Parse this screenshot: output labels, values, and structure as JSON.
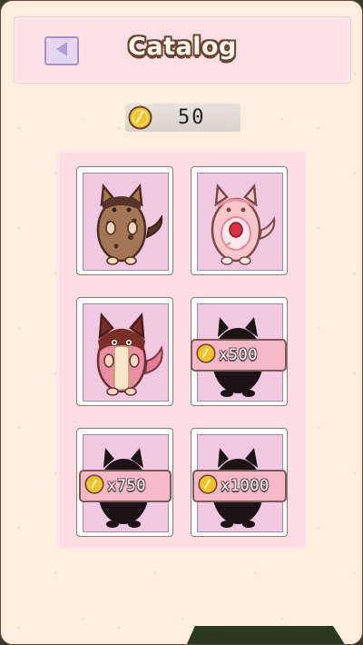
{
  "screen": {
    "title": "Catalog",
    "back_button_icon": "back-arrow-icon"
  },
  "wallet": {
    "coin_icon": "gold-coin-icon",
    "coins": "50"
  },
  "catalog": {
    "items": [
      {
        "id": "cookie-cat",
        "unlocked": true,
        "icon": "cookie-cat-icon",
        "price": ""
      },
      {
        "id": "donut-cat",
        "unlocked": true,
        "icon": "donut-cat-icon",
        "price": ""
      },
      {
        "id": "chocolate-cat",
        "unlocked": true,
        "icon": "chocolate-cat-icon",
        "price": ""
      },
      {
        "id": "locked-cat-1",
        "unlocked": false,
        "icon": "silhouette-cat-icon",
        "price": "x500"
      },
      {
        "id": "locked-cat-2",
        "unlocked": false,
        "icon": "silhouette-cat-icon",
        "price": "x750"
      },
      {
        "id": "locked-cat-3",
        "unlocked": false,
        "icon": "silhouette-cat-icon",
        "price": "x1000"
      }
    ]
  },
  "colors": {
    "background": "#fdeedd",
    "header_bg": "#fce0e4",
    "card_bg": "#f0c9e0",
    "price_tag": "#f7b8c6",
    "coin": "#f2c12e",
    "outline": "#6b4433"
  }
}
